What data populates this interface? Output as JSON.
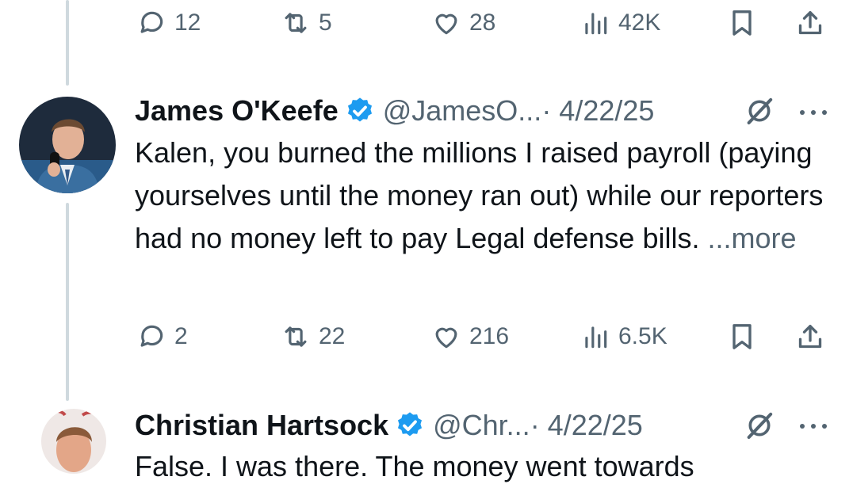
{
  "tweet0": {
    "actions": {
      "replies": "12",
      "retweets": "5",
      "likes": "28",
      "views": "42K"
    }
  },
  "tweet1": {
    "name": "James O'Keefe",
    "handle": "@JamesO...",
    "date": "· 4/22/25",
    "text": "Kalen, you burned the millions I raised payroll (paying yourselves until the money ran out) while our reporters had no money left to pay Legal defense bills.",
    "more": "...more",
    "actions": {
      "replies": "2",
      "retweets": "22",
      "likes": "216",
      "views": "6.5K"
    }
  },
  "tweet2": {
    "name": "Christian Hartsock",
    "handle": "@Chr...",
    "date": "· 4/22/25",
    "text": "False. I was there. The money went towards"
  },
  "colors": {
    "verified": "#1d9bf0",
    "muted": "#536471",
    "text": "#0f1419",
    "thread_line": "#cfd9de"
  }
}
